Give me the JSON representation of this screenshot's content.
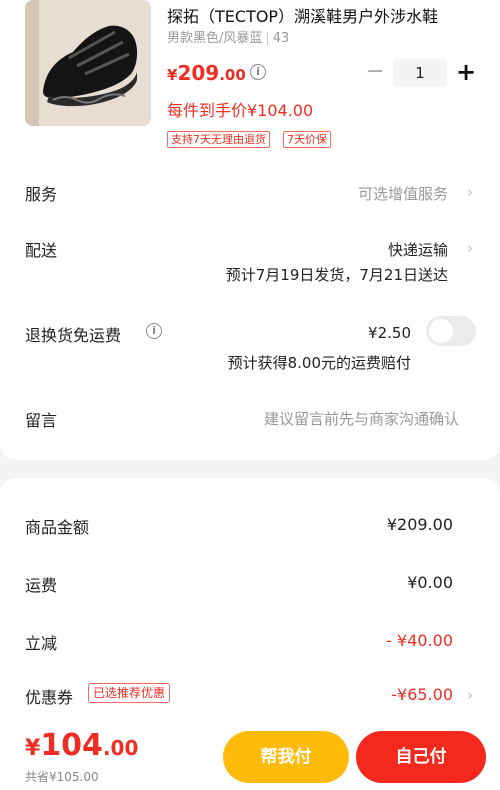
{
  "product": {
    "title": "探拓（TECTOP）溯溪鞋男户外涉水鞋",
    "variant": "男款黑色/风暴蓝",
    "size": "43",
    "price_currency": "¥",
    "price_integer": "209",
    "price_decimal": ".00",
    "quantity": "1",
    "minus": "−",
    "plus": "+",
    "final_price": "每件到手价¥104.00",
    "badges": [
      "支持7天无理由退货",
      "7天价保"
    ]
  },
  "rows": {
    "service_label": "服务",
    "service_value": "可选增值服务",
    "delivery_label": "配送",
    "delivery_value": "快递运输",
    "delivery_estimate": "预计7月19日发货，7月21日送达",
    "return_label": "退换货免运费",
    "return_value": "¥2.50",
    "return_note": "预计获得8.00元的运费赔付",
    "message_label": "留言",
    "message_placeholder": "建议留言前先与商家沟通确认"
  },
  "summary": {
    "goods_label": "商品金额",
    "goods_value": "¥209.00",
    "shipping_label": "运费",
    "shipping_value": "¥0.00",
    "discount_label": "立减",
    "discount_value": "- ¥40.00",
    "coupon_label": "优惠券",
    "coupon_tag": "已选推荐优惠",
    "coupon_value": "-¥65.00"
  },
  "footer": {
    "total_currency": "¥",
    "total_integer": "104",
    "total_decimal": ".00",
    "saved": "共省¥105.00",
    "help_pay": "帮我付",
    "pay": "自己付"
  },
  "icons": {
    "chevron": "›",
    "info": "i"
  },
  "colors": {
    "accent_red": "#f02d22",
    "help_button": "#ffba0a",
    "pay_button": "#f5281e"
  }
}
